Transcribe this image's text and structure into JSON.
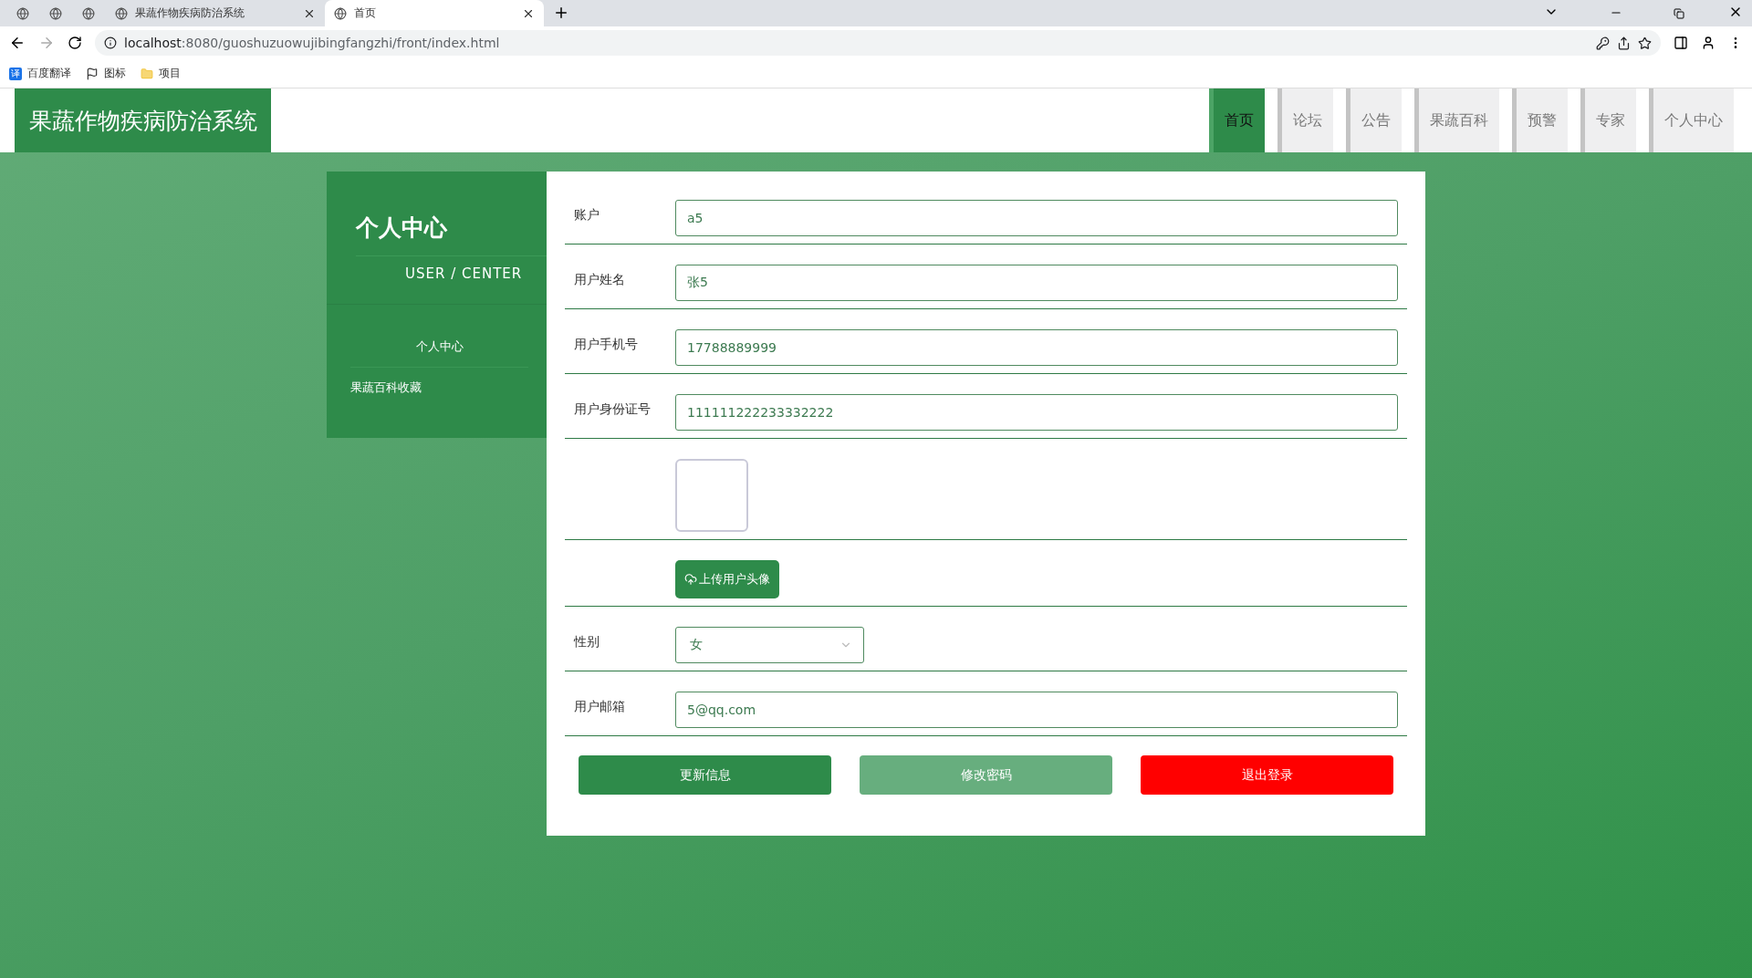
{
  "browser": {
    "tabs": [
      {
        "kind": "pinned",
        "selected": false
      },
      {
        "kind": "pinned",
        "selected": false
      },
      {
        "kind": "pinned",
        "selected": false
      },
      {
        "kind": "page",
        "label": "果蔬作物疾病防治系统",
        "selected": false
      },
      {
        "kind": "page",
        "label": "首页",
        "selected": true
      }
    ],
    "url_host": "localhost",
    "url_rest": ":8080/guoshuzuowujibingfangzhi/front/index.html",
    "bookmarks": [
      {
        "label": "百度翻译",
        "badge": "译"
      },
      {
        "label": "图标"
      },
      {
        "label": "项目"
      }
    ]
  },
  "site": {
    "title": "果蔬作物疾病防治系统",
    "nav": [
      {
        "label": "首页",
        "selected": true
      },
      {
        "label": "论坛",
        "selected": false
      },
      {
        "label": "公告",
        "selected": false
      },
      {
        "label": "果蔬百科",
        "selected": false
      },
      {
        "label": "预警",
        "selected": false
      },
      {
        "label": "专家",
        "selected": false
      },
      {
        "label": "个人中心",
        "selected": false
      }
    ]
  },
  "sidebar": {
    "title": "个人中心",
    "subtitle": "USER / CENTER",
    "items": [
      {
        "label": "个人中心",
        "selected": true
      },
      {
        "label": "果蔬百科收藏",
        "selected": false
      }
    ]
  },
  "form": {
    "fields": [
      {
        "kind": "text",
        "label": "账户",
        "value": "a5"
      },
      {
        "kind": "text",
        "label": "用户姓名",
        "value": "张5"
      },
      {
        "kind": "text",
        "label": "用户手机号",
        "value": "17788889999"
      },
      {
        "kind": "text",
        "label": "用户身份证号",
        "value": "111111222233332222"
      },
      {
        "kind": "image"
      },
      {
        "kind": "upload",
        "button": "上传用户头像"
      },
      {
        "kind": "select",
        "label": "性别",
        "value": "女"
      },
      {
        "kind": "text",
        "label": "用户邮箱",
        "value": "5@qq.com"
      }
    ],
    "buttons": [
      {
        "kind": "primary",
        "label": "更新信息"
      },
      {
        "kind": "secondary",
        "label": "修改密码"
      },
      {
        "kind": "danger",
        "label": "退出登录"
      }
    ]
  }
}
